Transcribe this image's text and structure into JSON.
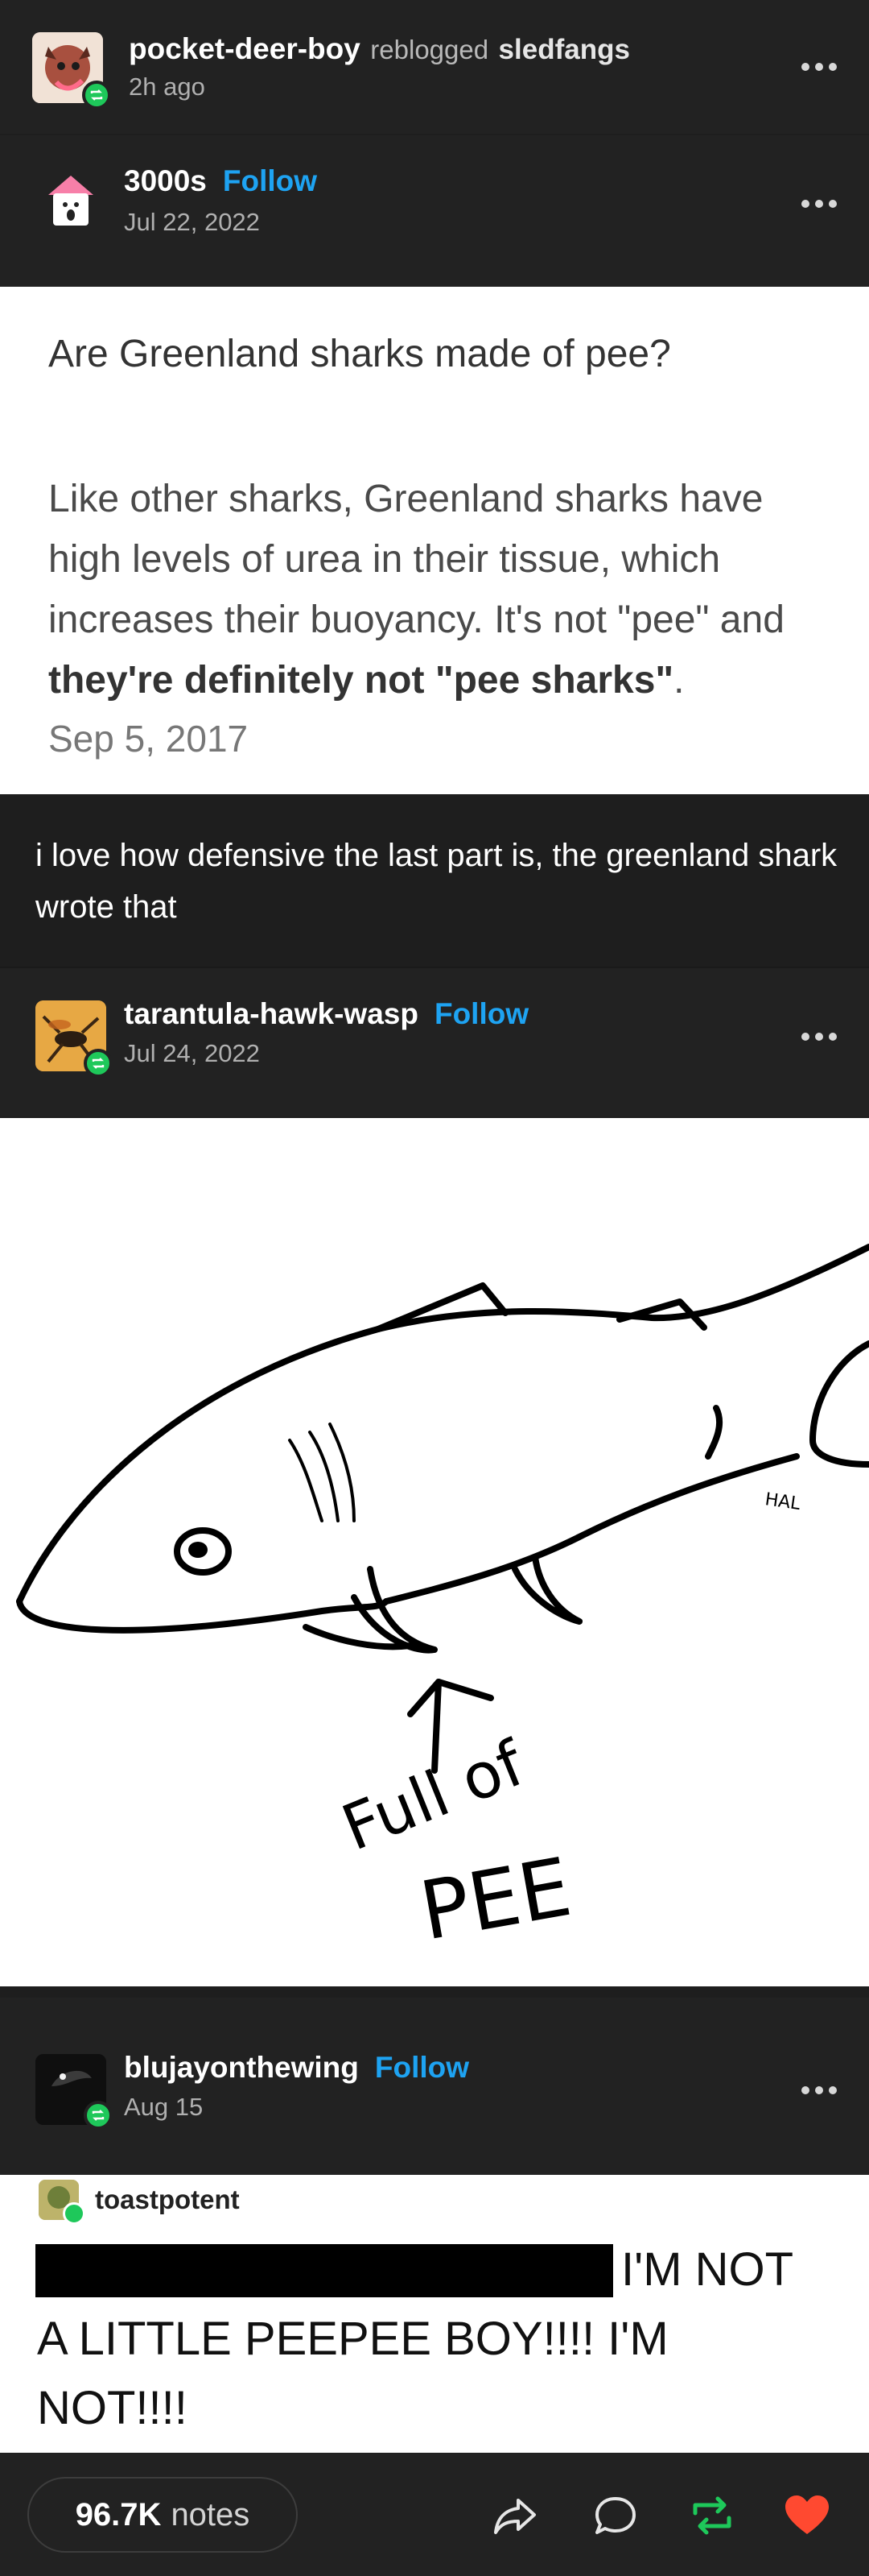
{
  "reblog_header": {
    "user": "pocket-deer-boy",
    "action": "reblogged",
    "source": "sledfangs",
    "time": "2h ago"
  },
  "post_3000s": {
    "user": "3000s",
    "follow": "Follow",
    "date": "Jul 22, 2022"
  },
  "ask": {
    "question": "Are Greenland sharks made of pee?",
    "answer_plain": "Like other sharks, Greenland sharks have high levels of urea in their tissue, which increases their buoyancy. It's not \"pee\" and",
    "answer_bold": "they're definitely not \"pee sharks\"",
    "answer_end": ".",
    "date": "Sep 5, 2017"
  },
  "comment": {
    "text": "i love how defensive the last part is, the greenland shark wrote that"
  },
  "post_wasp": {
    "user": "tarantula-hawk-wasp",
    "follow": "Follow",
    "date": "Jul 24, 2022"
  },
  "drawing": {
    "signature": "HAL",
    "caption_line1": "Full of",
    "caption_line2": "PEE"
  },
  "post_blujay": {
    "user": "blujayonthewing",
    "follow": "Follow",
    "date": "Aug 15"
  },
  "tweet": {
    "user": "toastpotent",
    "line1": "I'M NOT",
    "line2": "A LITTLE PEEPEE BOY!!!! I'M",
    "line3": "NOT!!!!"
  },
  "footer": {
    "notes_count": "96.7K",
    "notes_label": "notes"
  },
  "colors": {
    "follow": "#1ea3f2",
    "reblog": "#1ec85a",
    "like": "#ff4930",
    "background": "#222222"
  },
  "icons": [
    "more-icon",
    "reblog-badge-icon",
    "share-icon",
    "reply-icon",
    "reblog-icon",
    "like-icon"
  ]
}
